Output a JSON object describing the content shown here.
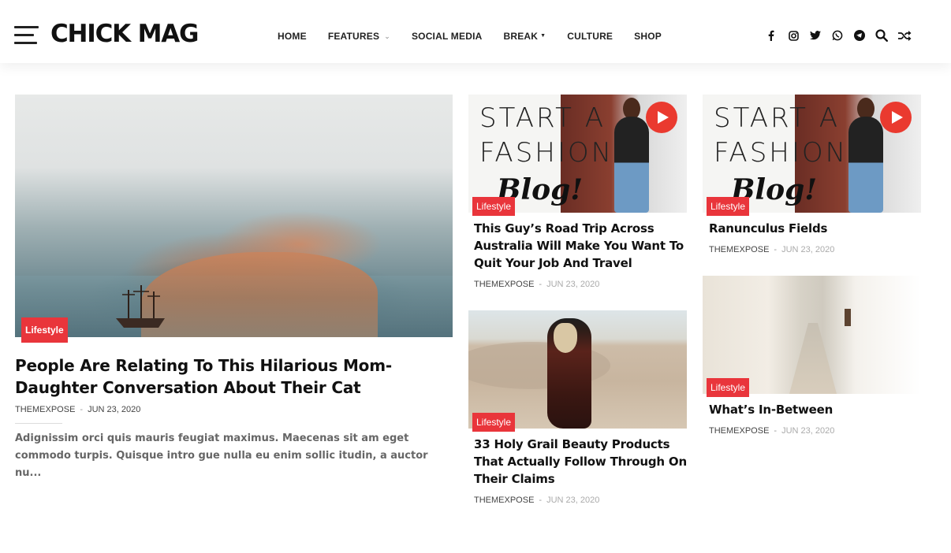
{
  "header": {
    "logo": "CHICK MAG",
    "nav": [
      {
        "label": "HOME"
      },
      {
        "label": "FEATURES"
      },
      {
        "label": "SOCIAL MEDIA"
      },
      {
        "label": "BREAK"
      },
      {
        "label": "CULTURE"
      },
      {
        "label": "SHOP"
      }
    ],
    "social_icons": [
      "facebook-icon",
      "instagram-icon",
      "twitter-icon",
      "whatsapp-icon",
      "telegram-icon",
      "search-icon",
      "shuffle-icon"
    ]
  },
  "colors": {
    "accent": "#e9353b",
    "play": "#ea3a2f",
    "text": "#111111"
  },
  "hero": {
    "category": "Lifestyle",
    "title": "People Are Relating To This Hilarious Mom-Daughter Conversation About Their Cat",
    "author": "THEMEXPOSE",
    "separator": "-",
    "date": "JUN 23, 2020",
    "excerpt": "Adignissim orci quis mauris feugiat maximus. Maecenas sit am eget commodo turpis. Quisque intro gue nulla eu enim sollic itudin, a auctor nu..."
  },
  "posts": [
    {
      "category": "Lifestyle",
      "title": "This Guy’s Road Trip Across Australia Will Make You Want To Quit Your Job And Travel",
      "author": "THEMEXPOSE",
      "separator": "-",
      "date": "JUN 23, 2020",
      "image_text_1": "START A",
      "image_text_2": "FASHION",
      "image_text_3": "Blog!"
    },
    {
      "category": "Lifestyle",
      "title": "Ranunculus Fields",
      "author": "THEMEXPOSE",
      "separator": "-",
      "date": "JUN 23, 2020",
      "image_text_1": "START A",
      "image_text_2": "FASHION",
      "image_text_3": "Blog!"
    },
    {
      "category": "Lifestyle",
      "title": "33 Holy Grail Beauty Products That Actually Follow Through On Their Claims",
      "author": "THEMEXPOSE",
      "separator": "-",
      "date": "JUN 23, 2020"
    },
    {
      "category": "Lifestyle",
      "title": "What’s In-Between",
      "author": "THEMEXPOSE",
      "separator": "-",
      "date": "JUN 23, 2020"
    }
  ]
}
